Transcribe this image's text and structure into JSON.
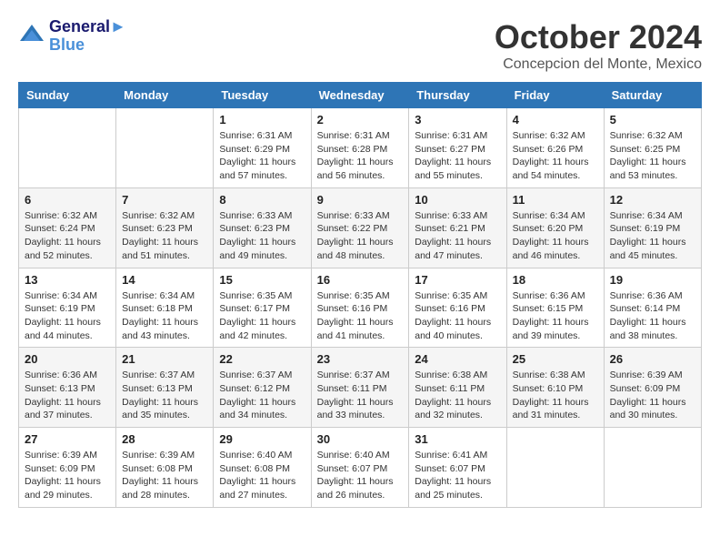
{
  "header": {
    "logo_line1": "General",
    "logo_line2": "Blue",
    "month": "October 2024",
    "location": "Concepcion del Monte, Mexico"
  },
  "weekdays": [
    "Sunday",
    "Monday",
    "Tuesday",
    "Wednesday",
    "Thursday",
    "Friday",
    "Saturday"
  ],
  "weeks": [
    [
      {
        "day": "",
        "sunrise": "",
        "sunset": "",
        "daylight": ""
      },
      {
        "day": "",
        "sunrise": "",
        "sunset": "",
        "daylight": ""
      },
      {
        "day": "1",
        "sunrise": "Sunrise: 6:31 AM",
        "sunset": "Sunset: 6:29 PM",
        "daylight": "Daylight: 11 hours and 57 minutes."
      },
      {
        "day": "2",
        "sunrise": "Sunrise: 6:31 AM",
        "sunset": "Sunset: 6:28 PM",
        "daylight": "Daylight: 11 hours and 56 minutes."
      },
      {
        "day": "3",
        "sunrise": "Sunrise: 6:31 AM",
        "sunset": "Sunset: 6:27 PM",
        "daylight": "Daylight: 11 hours and 55 minutes."
      },
      {
        "day": "4",
        "sunrise": "Sunrise: 6:32 AM",
        "sunset": "Sunset: 6:26 PM",
        "daylight": "Daylight: 11 hours and 54 minutes."
      },
      {
        "day": "5",
        "sunrise": "Sunrise: 6:32 AM",
        "sunset": "Sunset: 6:25 PM",
        "daylight": "Daylight: 11 hours and 53 minutes."
      }
    ],
    [
      {
        "day": "6",
        "sunrise": "Sunrise: 6:32 AM",
        "sunset": "Sunset: 6:24 PM",
        "daylight": "Daylight: 11 hours and 52 minutes."
      },
      {
        "day": "7",
        "sunrise": "Sunrise: 6:32 AM",
        "sunset": "Sunset: 6:23 PM",
        "daylight": "Daylight: 11 hours and 51 minutes."
      },
      {
        "day": "8",
        "sunrise": "Sunrise: 6:33 AM",
        "sunset": "Sunset: 6:23 PM",
        "daylight": "Daylight: 11 hours and 49 minutes."
      },
      {
        "day": "9",
        "sunrise": "Sunrise: 6:33 AM",
        "sunset": "Sunset: 6:22 PM",
        "daylight": "Daylight: 11 hours and 48 minutes."
      },
      {
        "day": "10",
        "sunrise": "Sunrise: 6:33 AM",
        "sunset": "Sunset: 6:21 PM",
        "daylight": "Daylight: 11 hours and 47 minutes."
      },
      {
        "day": "11",
        "sunrise": "Sunrise: 6:34 AM",
        "sunset": "Sunset: 6:20 PM",
        "daylight": "Daylight: 11 hours and 46 minutes."
      },
      {
        "day": "12",
        "sunrise": "Sunrise: 6:34 AM",
        "sunset": "Sunset: 6:19 PM",
        "daylight": "Daylight: 11 hours and 45 minutes."
      }
    ],
    [
      {
        "day": "13",
        "sunrise": "Sunrise: 6:34 AM",
        "sunset": "Sunset: 6:19 PM",
        "daylight": "Daylight: 11 hours and 44 minutes."
      },
      {
        "day": "14",
        "sunrise": "Sunrise: 6:34 AM",
        "sunset": "Sunset: 6:18 PM",
        "daylight": "Daylight: 11 hours and 43 minutes."
      },
      {
        "day": "15",
        "sunrise": "Sunrise: 6:35 AM",
        "sunset": "Sunset: 6:17 PM",
        "daylight": "Daylight: 11 hours and 42 minutes."
      },
      {
        "day": "16",
        "sunrise": "Sunrise: 6:35 AM",
        "sunset": "Sunset: 6:16 PM",
        "daylight": "Daylight: 11 hours and 41 minutes."
      },
      {
        "day": "17",
        "sunrise": "Sunrise: 6:35 AM",
        "sunset": "Sunset: 6:16 PM",
        "daylight": "Daylight: 11 hours and 40 minutes."
      },
      {
        "day": "18",
        "sunrise": "Sunrise: 6:36 AM",
        "sunset": "Sunset: 6:15 PM",
        "daylight": "Daylight: 11 hours and 39 minutes."
      },
      {
        "day": "19",
        "sunrise": "Sunrise: 6:36 AM",
        "sunset": "Sunset: 6:14 PM",
        "daylight": "Daylight: 11 hours and 38 minutes."
      }
    ],
    [
      {
        "day": "20",
        "sunrise": "Sunrise: 6:36 AM",
        "sunset": "Sunset: 6:13 PM",
        "daylight": "Daylight: 11 hours and 37 minutes."
      },
      {
        "day": "21",
        "sunrise": "Sunrise: 6:37 AM",
        "sunset": "Sunset: 6:13 PM",
        "daylight": "Daylight: 11 hours and 35 minutes."
      },
      {
        "day": "22",
        "sunrise": "Sunrise: 6:37 AM",
        "sunset": "Sunset: 6:12 PM",
        "daylight": "Daylight: 11 hours and 34 minutes."
      },
      {
        "day": "23",
        "sunrise": "Sunrise: 6:37 AM",
        "sunset": "Sunset: 6:11 PM",
        "daylight": "Daylight: 11 hours and 33 minutes."
      },
      {
        "day": "24",
        "sunrise": "Sunrise: 6:38 AM",
        "sunset": "Sunset: 6:11 PM",
        "daylight": "Daylight: 11 hours and 32 minutes."
      },
      {
        "day": "25",
        "sunrise": "Sunrise: 6:38 AM",
        "sunset": "Sunset: 6:10 PM",
        "daylight": "Daylight: 11 hours and 31 minutes."
      },
      {
        "day": "26",
        "sunrise": "Sunrise: 6:39 AM",
        "sunset": "Sunset: 6:09 PM",
        "daylight": "Daylight: 11 hours and 30 minutes."
      }
    ],
    [
      {
        "day": "27",
        "sunrise": "Sunrise: 6:39 AM",
        "sunset": "Sunset: 6:09 PM",
        "daylight": "Daylight: 11 hours and 29 minutes."
      },
      {
        "day": "28",
        "sunrise": "Sunrise: 6:39 AM",
        "sunset": "Sunset: 6:08 PM",
        "daylight": "Daylight: 11 hours and 28 minutes."
      },
      {
        "day": "29",
        "sunrise": "Sunrise: 6:40 AM",
        "sunset": "Sunset: 6:08 PM",
        "daylight": "Daylight: 11 hours and 27 minutes."
      },
      {
        "day": "30",
        "sunrise": "Sunrise: 6:40 AM",
        "sunset": "Sunset: 6:07 PM",
        "daylight": "Daylight: 11 hours and 26 minutes."
      },
      {
        "day": "31",
        "sunrise": "Sunrise: 6:41 AM",
        "sunset": "Sunset: 6:07 PM",
        "daylight": "Daylight: 11 hours and 25 minutes."
      },
      {
        "day": "",
        "sunrise": "",
        "sunset": "",
        "daylight": ""
      },
      {
        "day": "",
        "sunrise": "",
        "sunset": "",
        "daylight": ""
      }
    ]
  ]
}
